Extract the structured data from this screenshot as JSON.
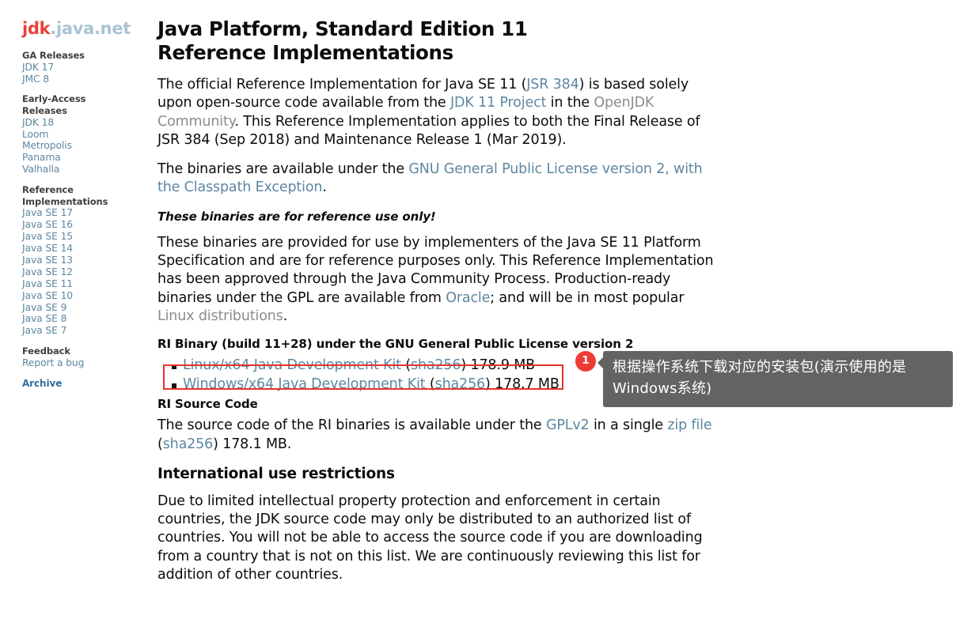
{
  "site": {
    "logo_primary": "jdk",
    "logo_secondary": ".java.net"
  },
  "sidebar": {
    "groups": [
      {
        "heading": "GA Releases",
        "heading_lines": [
          "GA Releases"
        ],
        "links": [
          "JDK 17",
          "JMC 8"
        ]
      },
      {
        "heading": "Early-Access Releases",
        "heading_lines": [
          "Early-Access",
          "Releases"
        ],
        "links": [
          "JDK 18",
          "Loom",
          "Metropolis",
          "Panama",
          "Valhalla"
        ]
      },
      {
        "heading": "Reference Implementations",
        "heading_lines": [
          "Reference",
          "Implementations"
        ],
        "links": [
          "Java SE 17",
          "Java SE 16",
          "Java SE 15",
          "Java SE 14",
          "Java SE 13",
          "Java SE 12",
          "Java SE 11",
          "Java SE 10",
          "Java SE 9",
          "Java SE 8",
          "Java SE 7"
        ]
      },
      {
        "heading": "Feedback",
        "heading_lines": [
          "Feedback"
        ],
        "links": [
          "Report a bug"
        ]
      }
    ],
    "archive_link": "Archive"
  },
  "main": {
    "title": "Java Platform, Standard Edition 11 Reference Implementations",
    "para1": {
      "t1": "The official Reference Implementation for Java SE 11 (",
      "link1": "JSR 384",
      "t2": ") is based solely upon open-source code available from the ",
      "link2": "JDK 11 Project",
      "t3": " in the ",
      "link3": "OpenJDK Community",
      "t4": ". This Reference Implementation applies to both the Final Release of JSR 384 (Sep 2018) and Maintenance Release 1 (Mar 2019)."
    },
    "para2": {
      "t1": "The binaries are available under the ",
      "link1": "GNU General Public License version 2, with the Classpath Exception",
      "t2": "."
    },
    "note": "These binaries are for reference use only!",
    "para3": {
      "t1": "These binaries are provided for use by implementers of the Java SE 11 Platform Specification and are for reference purposes only. This Reference Implementation has been approved through the Java Community Process. Production-ready binaries under the GPL are available from ",
      "link1": "Oracle",
      "t2": "; and will be in most popular ",
      "link2": "Linux distributions",
      "t3": "."
    },
    "ri_binary_heading": "RI Binary (build 11+28) under the GNU General Public License version 2",
    "downloads": [
      {
        "name": "Linux/x64 Java Development Kit",
        "open_paren": " (",
        "checksum": "sha256",
        "close_paren": ") ",
        "size": "178.9 MB"
      },
      {
        "name": "Windows/x64 Java Development Kit",
        "open_paren": " (",
        "checksum": "sha256",
        "close_paren": ") ",
        "size": "178.7 MB"
      }
    ],
    "ri_source_heading": "RI Source Code",
    "para4": {
      "t1": "The source code of the RI binaries is available under the ",
      "link1": "GPLv2",
      "t2": " in a single ",
      "link2": "zip file",
      "t3": " (",
      "link3": "sha256",
      "t4": ") 178.1 MB."
    },
    "intl_heading": "International use restrictions",
    "para5": "Due to limited intellectual property protection and enforcement in certain countries, the JDK source code may only be distributed to an authorized list of countries. You will not be able to access the source code if you are downloading from a country that is not on this list. We are continuously reviewing this list for addition of other countries."
  },
  "annotation": {
    "badge_number": "1",
    "tooltip_text": "根据操作系统下载对应的安装包(演示使用的是Windows系统)"
  },
  "colors": {
    "logo_red": "#e8413a",
    "logo_blue": "#a8c3d4",
    "link_blue": "#5d87a1",
    "link_muted": "#8c8c8c",
    "highlight_red": "#e8312a",
    "badge_red": "#ee3b34",
    "tooltip_gray": "#636363"
  }
}
